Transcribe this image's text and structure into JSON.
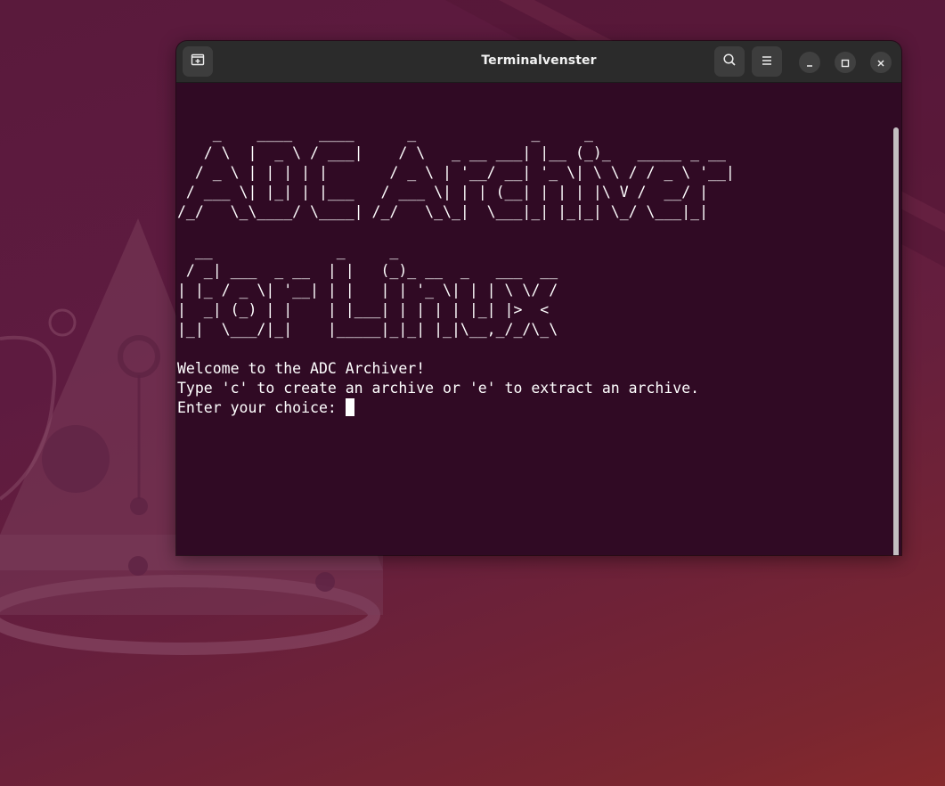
{
  "window": {
    "title": "Terminalvenster"
  },
  "icons": {
    "new_tab": "new-tab-icon",
    "search": "search-icon",
    "menu": "hamburger-menu-icon",
    "minimize": "minimize-icon",
    "maximize": "maximize-icon",
    "close": "close-icon"
  },
  "colors": {
    "terminal_bg": "#300a24",
    "titlebar_bg": "#2b2b2b",
    "text": "#ffffff"
  },
  "terminal": {
    "banner_lines": [
      "",
      "    _    ____   ____      _             _     _",
      "   / \\  |  _ \\ / ___|    / \\   _ __ ___| |__ (_)_   _____ _ __",
      "  / _ \\ | | | | |       / _ \\ | '__/ __| '_ \\| \\ \\ / / _ \\ '__|",
      " / ___ \\| |_| | |___   / ___ \\| | | (__| | | | |\\ V /  __/ |",
      "/_/   \\_\\____/ \\____| /_/   \\_\\_|  \\___|_| |_|_| \\_/ \\___|_|",
      "",
      "  __              _     _",
      " / _| ___  _ __  | |   (_)_ __  _   ___  __",
      "| |_ / _ \\| '__| | |   | | '_ \\| | | \\ \\/ /",
      "|  _| (_) | |    | |___| | | | | |_| |>  <",
      "|_|  \\___/|_|    |_____|_|_| |_|\\__,_/_/\\_\\",
      ""
    ],
    "welcome": "Welcome to the ADC Archiver!",
    "instructions": "Type 'c' to create an archive or 'e' to extract an archive.",
    "prompt": "Enter your choice: "
  }
}
